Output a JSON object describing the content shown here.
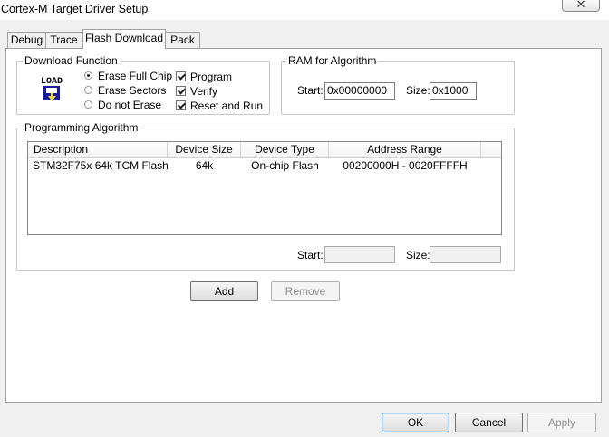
{
  "window": {
    "title": "Cortex-M Target Driver Setup",
    "close_glyph": "✕"
  },
  "tabs": [
    {
      "label": "Debug",
      "active": false
    },
    {
      "label": "Trace",
      "active": false
    },
    {
      "label": "Flash Download",
      "active": true
    },
    {
      "label": "Pack",
      "active": false
    }
  ],
  "download_function": {
    "legend": "Download Function",
    "icon_text": "LOAD",
    "radios": [
      {
        "label": "Erase Full Chip",
        "selected": true
      },
      {
        "label": "Erase Sectors",
        "selected": false
      },
      {
        "label": "Do not Erase",
        "selected": false
      }
    ],
    "checks": [
      {
        "label": "Program",
        "checked": true
      },
      {
        "label": "Verify",
        "checked": true
      },
      {
        "label": "Reset and Run",
        "checked": true
      }
    ]
  },
  "ram": {
    "legend": "RAM for Algorithm",
    "start_label": "Start:",
    "start_value": "0x00000000",
    "size_label": "Size:",
    "size_value": "0x1000"
  },
  "programming": {
    "legend": "Programming Algorithm",
    "columns": [
      "Description",
      "Device Size",
      "Device Type",
      "Address Range"
    ],
    "rows": [
      [
        "STM32F75x 64k TCM Flash",
        "64k",
        "On-chip Flash",
        "00200000H - 0020FFFFH"
      ]
    ],
    "start_label": "Start:",
    "start_value": "",
    "size_label": "Size:",
    "size_value": ""
  },
  "algorithm_buttons": {
    "add": "Add",
    "remove": "Remove"
  },
  "dialog_buttons": {
    "ok": "OK",
    "cancel": "Cancel",
    "apply": "Apply"
  },
  "colors": {
    "window_bg": "#f0f0f0",
    "panel_bg": "#ffffff",
    "default_button_border": "#3c7fb1"
  }
}
